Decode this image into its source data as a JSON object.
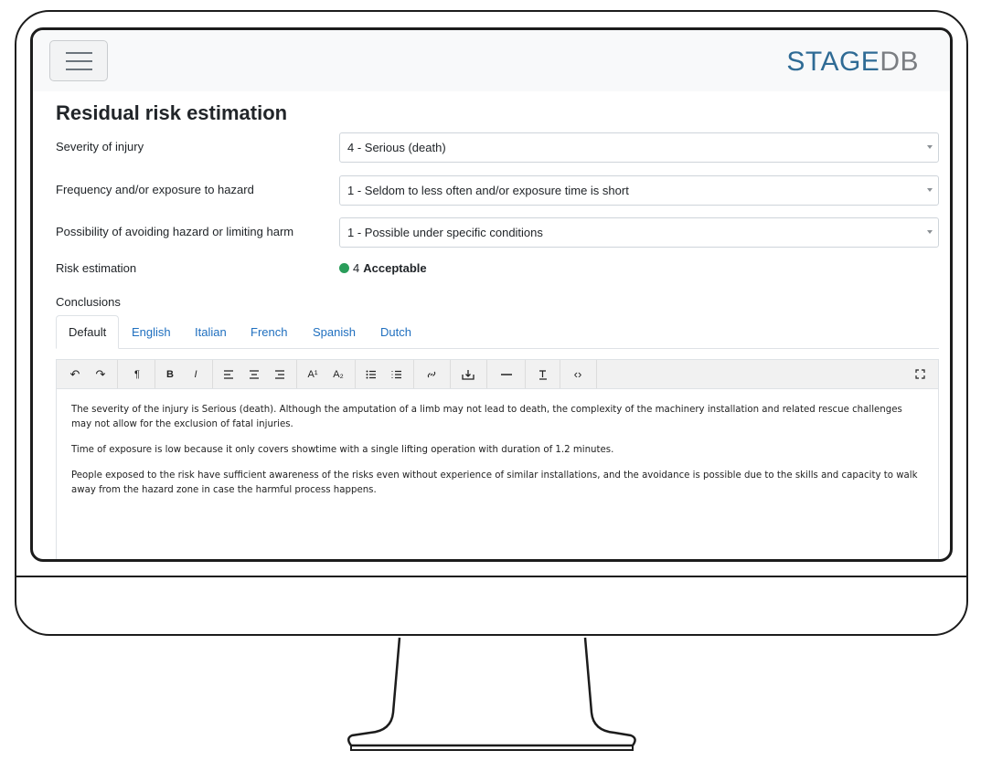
{
  "header": {
    "brand_part1": "STAGE",
    "brand_part2": "DB"
  },
  "page_title": "Residual risk estimation",
  "fields": [
    {
      "label": "Severity of injury",
      "value": "4 - Serious (death)"
    },
    {
      "label": "Frequency and/or exposure to hazard",
      "value": "1 - Seldom to less often and/or exposure time is short"
    },
    {
      "label": "Possibility of avoiding hazard or limiting harm",
      "value": "1 - Possible under specific conditions"
    }
  ],
  "risk": {
    "label": "Risk estimation",
    "score": "4",
    "level": "Acceptable",
    "color": "#2a9d5a"
  },
  "conclusions_label": "Conclusions",
  "tabs": [
    "Default",
    "English",
    "Italian",
    "French",
    "Spanish",
    "Dutch"
  ],
  "toolbar_icons": [
    "undo-icon",
    "redo-icon",
    "paragraph-format-icon",
    "bold-icon",
    "italic-icon",
    "align-left-icon",
    "align-center-icon",
    "align-right-icon",
    "superscript-icon",
    "subscript-icon",
    "unordered-list-icon",
    "ordered-list-icon",
    "link-icon",
    "insert-file-icon",
    "horizontal-line-icon",
    "clear-format-icon",
    "code-view-icon",
    "fullscreen-icon"
  ],
  "toolbar_glyphs": {
    "bold": "B",
    "italic": "I",
    "superscript": "A¹",
    "subscript": "A₂",
    "paragraph": "¶",
    "undo": "↶",
    "redo": "↷",
    "code": "‹›"
  },
  "content": [
    "The severity of the injury is Serious (death). Although the amputation of a limb may not lead to death, the complexity of the machinery installation and related rescue challenges may not allow for the exclusion of fatal injuries.",
    "Time of exposure is low because it only covers showtime with a single lifting operation with duration of 1.2 minutes.",
    "People exposed to the risk have sufficient awareness of the risks even without experience of similar installations, and the avoidance is possible due to the skills and capacity to walk away from the hazard zone in case the harmful process happens."
  ]
}
